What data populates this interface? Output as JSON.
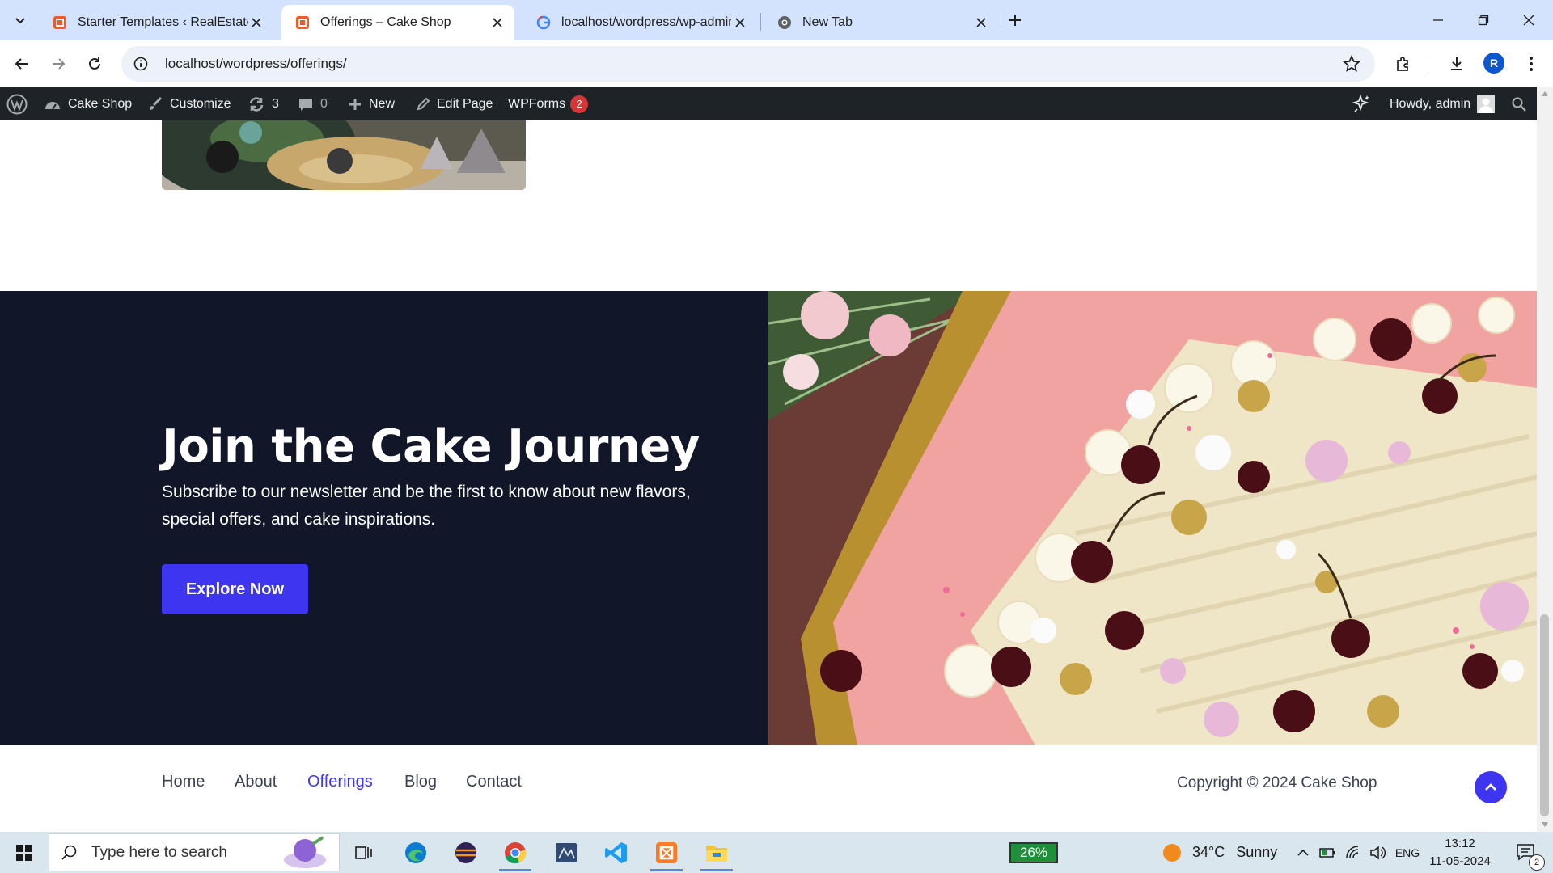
{
  "browser": {
    "tabs": [
      {
        "title": "Starter Templates ‹ RealEstate-E",
        "favicon": "cake-shop-favicon",
        "active": false
      },
      {
        "title": "Offerings – Cake Shop",
        "favicon": "cake-shop-favicon",
        "active": true
      },
      {
        "title": "localhost/wordpress/wp-admin",
        "favicon": "google-icon",
        "active": false
      },
      {
        "title": "New Tab",
        "favicon": "chrome-icon",
        "active": false
      }
    ],
    "url": "localhost/wordpress/offerings/",
    "profile_initial": "R"
  },
  "admin_bar": {
    "site_name": "Cake Shop",
    "customize": "Customize",
    "updates_count": "3",
    "comments_count": "0",
    "new_label": "New",
    "edit_page": "Edit Page",
    "wpforms": "WPForms",
    "wpforms_badge": "2",
    "howdy": "Howdy, admin"
  },
  "page": {
    "join": {
      "title": "Join the Cake Journey",
      "subtitle": "Subscribe to our newsletter and be the first to know about new flavors, special offers, and cake inspirations.",
      "button": "Explore Now"
    },
    "footer": {
      "nav": [
        "Home",
        "About",
        "Offerings",
        "Blog",
        "Contact"
      ],
      "active_nav": "Offerings",
      "copyright": "Copyright © 2024 Cake Shop"
    }
  },
  "taskbar": {
    "search_placeholder": "Type here to search",
    "battery": "26%",
    "weather_temp": "34°C",
    "weather_cond": "Sunny",
    "lang": "ENG",
    "time": "13:12",
    "date": "11-05-2024",
    "notifications": "2"
  },
  "colors": {
    "accent": "#3d35f0",
    "dark_section": "#111729",
    "admin_bar": "#1d2327",
    "tabstrip": "#d3e3fd"
  }
}
